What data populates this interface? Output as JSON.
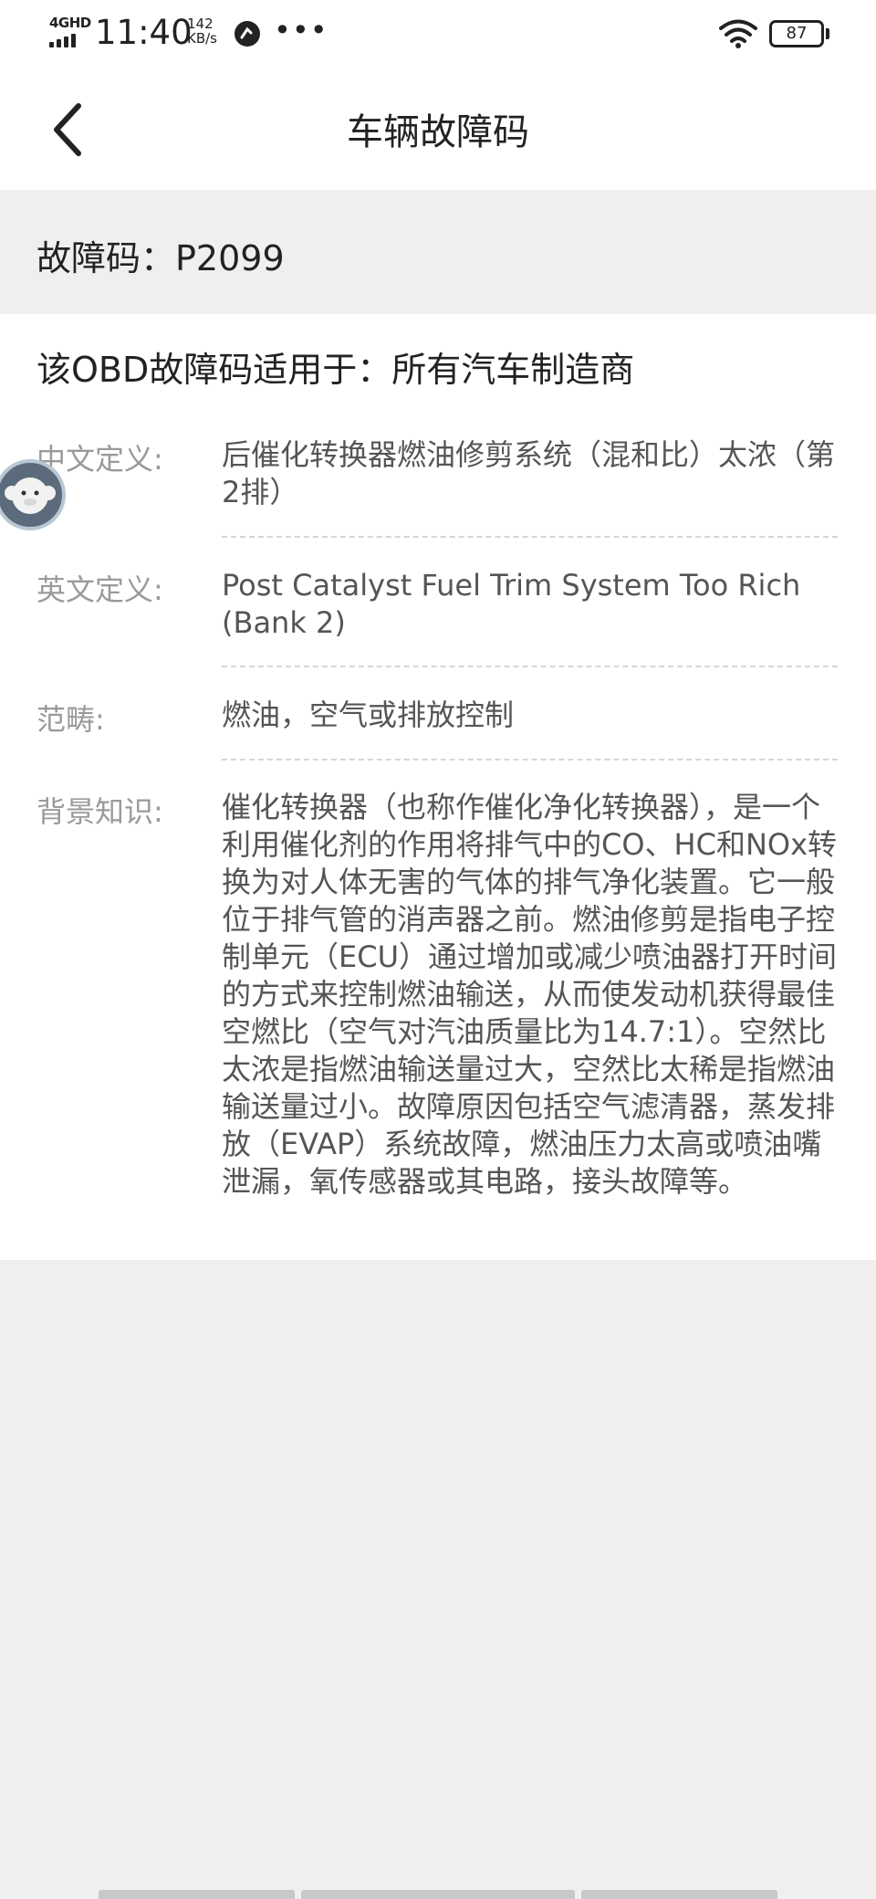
{
  "status_bar": {
    "network": "4GHD",
    "time": "11:40",
    "speed_value": "142",
    "speed_unit": "KB/s",
    "more": "•••",
    "battery": "87"
  },
  "nav": {
    "title": "车辆故障码",
    "back_icon": "chevron-left-icon"
  },
  "code": {
    "label": "故障码：",
    "value": "P2099"
  },
  "detail": {
    "applies_to": "该OBD故障码适用于：所有汽车制造商",
    "rows": [
      {
        "label": "中文定义:",
        "value": "后催化转换器燃油修剪系统（混和比）太浓（第2排）"
      },
      {
        "label": "英文定义:",
        "value": "Post Catalyst Fuel Trim System Too Rich (Bank 2)"
      },
      {
        "label": "范畴:",
        "value": "燃油，空气或排放控制"
      },
      {
        "label": "背景知识:",
        "value": "催化转换器（也称作催化净化转换器），是一个利用催化剂的作用将排气中的CO、HC和NOx转换为对人体无害的气体的排气净化装置。它一般位于排气管的消声器之前。燃油修剪是指电子控制单元（ECU）通过增加或减少喷油器打开时间的方式来控制燃油输送，从而使发动机获得最佳空燃比（空气对汽油质量比为14.7:1）。空然比太浓是指燃油输送量过大，空然比太稀是指燃油输送量过小。故障原因包括空气滤清器，蒸发排放（EVAP）系统故障，燃油压力太高或喷油嘴泄漏，氧传感器或其电路，接头故障等。"
      }
    ]
  },
  "colors": {
    "background": "#efefef",
    "card": "#ffffff",
    "label": "#9a9a9a",
    "value": "#555555",
    "divider": "#d6d6d6"
  }
}
